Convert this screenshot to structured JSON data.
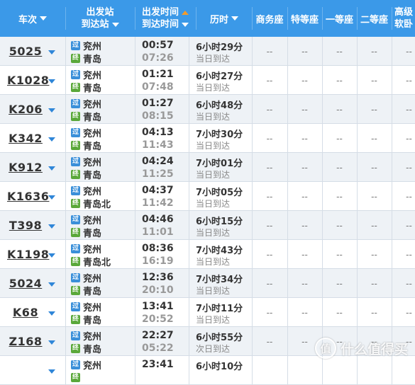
{
  "header": {
    "train": "车次",
    "depart_station": "出发站",
    "arrive_station": "到达站",
    "depart_time": "出发时间",
    "arrive_time": "到达时间",
    "duration": "历时",
    "seat_business": "商务座",
    "seat_premium": "特等座",
    "seat_first": "一等座",
    "seat_second": "二等座",
    "seat_soft_line1": "高级",
    "seat_soft_line2": "软卧"
  },
  "rows": [
    {
      "train": "5025",
      "from": "兖州",
      "to": "青岛",
      "dep": "00:57",
      "arr": "07:26",
      "dur": "6小时29分",
      "day": "当日到达",
      "seats": [
        "--",
        "--",
        "--",
        "--",
        "--"
      ]
    },
    {
      "train": "K1028",
      "from": "兖州",
      "to": "青岛",
      "dep": "01:21",
      "arr": "07:48",
      "dur": "6小时27分",
      "day": "当日到达",
      "seats": [
        "--",
        "--",
        "--",
        "--",
        "--"
      ]
    },
    {
      "train": "K206",
      "from": "兖州",
      "to": "青岛",
      "dep": "01:27",
      "arr": "08:15",
      "dur": "6小时48分",
      "day": "当日到达",
      "seats": [
        "--",
        "--",
        "--",
        "--",
        "--"
      ]
    },
    {
      "train": "K342",
      "from": "兖州",
      "to": "青岛",
      "dep": "04:13",
      "arr": "11:43",
      "dur": "7小时30分",
      "day": "当日到达",
      "seats": [
        "--",
        "--",
        "--",
        "--",
        "--"
      ]
    },
    {
      "train": "K912",
      "from": "兖州",
      "to": "青岛",
      "dep": "04:24",
      "arr": "11:25",
      "dur": "7小时01分",
      "day": "当日到达",
      "seats": [
        "--",
        "--",
        "--",
        "--",
        "--"
      ]
    },
    {
      "train": "K1636",
      "from": "兖州",
      "to": "青岛北",
      "dep": "04:37",
      "arr": "11:42",
      "dur": "7小时05分",
      "day": "当日到达",
      "seats": [
        "--",
        "--",
        "--",
        "--",
        "--"
      ]
    },
    {
      "train": "T398",
      "from": "兖州",
      "to": "青岛",
      "dep": "04:46",
      "arr": "11:01",
      "dur": "6小时15分",
      "day": "当日到达",
      "seats": [
        "--",
        "--",
        "--",
        "--",
        "--"
      ]
    },
    {
      "train": "K1198",
      "from": "兖州",
      "to": "青岛北",
      "dep": "08:36",
      "arr": "16:19",
      "dur": "7小时43分",
      "day": "当日到达",
      "seats": [
        "--",
        "--",
        "--",
        "--",
        "--"
      ]
    },
    {
      "train": "5024",
      "from": "兖州",
      "to": "青岛",
      "dep": "12:36",
      "arr": "20:10",
      "dur": "7小时34分",
      "day": "当日到达",
      "seats": [
        "--",
        "--",
        "--",
        "--",
        "--"
      ]
    },
    {
      "train": "K68",
      "from": "兖州",
      "to": "青岛",
      "dep": "13:41",
      "arr": "20:52",
      "dur": "7小时11分",
      "day": "当日到达",
      "seats": [
        "--",
        "--",
        "--",
        "--",
        "--"
      ]
    },
    {
      "train": "Z168",
      "from": "兖州",
      "to": "青岛",
      "dep": "22:27",
      "arr": "05:22",
      "dur": "6小时55分",
      "day": "次日到达",
      "seats": [
        "--",
        "--",
        "--",
        "--",
        "--"
      ]
    },
    {
      "train": "",
      "from": "兖州",
      "to": "",
      "dep": "23:41",
      "arr": "",
      "dur": "6小时10分",
      "day": "",
      "seats": [
        "",
        "",
        "",
        "",
        ""
      ]
    }
  ],
  "badges": {
    "pass": "过",
    "end": "终"
  },
  "watermark": {
    "logo": "值",
    "text": "什么值得买"
  },
  "colors": {
    "header": "#3b99e8",
    "sort_arrow": "#f39b2a",
    "dropdown": "#2f86d8",
    "row_alt": "#eef2f6"
  }
}
